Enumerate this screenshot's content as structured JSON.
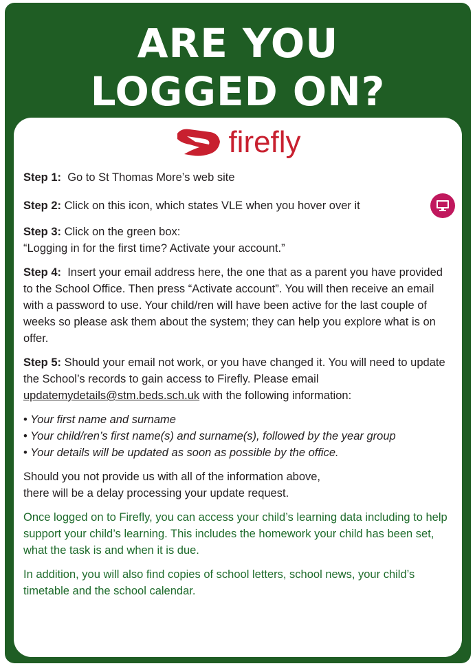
{
  "title": {
    "line1": "ARE YOU",
    "line2": "LOGGED ON?"
  },
  "logo": {
    "word": "firefly",
    "color": "#c8202f"
  },
  "colors": {
    "background": "#1f5d24",
    "card": "#ffffff",
    "accent_text": "#1f6b2c",
    "icon_bg": "#c0185d"
  },
  "steps": [
    {
      "label": "Step 1:",
      "text": "Go to St Thomas More’s web site"
    },
    {
      "label": "Step 2:",
      "text": "Click on this icon, which states VLE when you hover over it",
      "icon": "monitor-icon"
    },
    {
      "label": "Step 3:",
      "text": "Click on the green box:",
      "text2": "“Logging in for the first time?  Activate your account.”"
    },
    {
      "label": "Step 4:",
      "text": "Insert your email address here, the one that as a parent you have provided to the School Office.  Then press “Activate account”.  You will then receive an email with a password to use. Your child/ren will have been active for the last couple of weeks so please ask them about the system; they can help you explore what is on offer."
    },
    {
      "label": "Step 5:",
      "text": "Should your email not work, or you have changed it.  You will need to update the School’s records to gain access to Firefly.  Please email",
      "email": "updatemydetails@stm.beds.sch.uk",
      "text_after": "with the following information:"
    }
  ],
  "bullets": [
    "Your first name and surname",
    "Your child/ren’s first name(s) and surname(s), followed by the year group",
    "Your details will be updated as soon as possible by the office."
  ],
  "bullet_char": "•",
  "notice": {
    "line1": "Should you not provide us with all of the information above,",
    "line2": "there will be a delay processing your update request."
  },
  "green_paragraphs": [
    "Once logged on to Firefly, you can access your child’s learning data including to help support your child’s learning. This includes the homework your child has been set, what the task is and when it is due.",
    "In addition, you will also find copies of school letters, school news, your child’s timetable and the school calendar."
  ]
}
